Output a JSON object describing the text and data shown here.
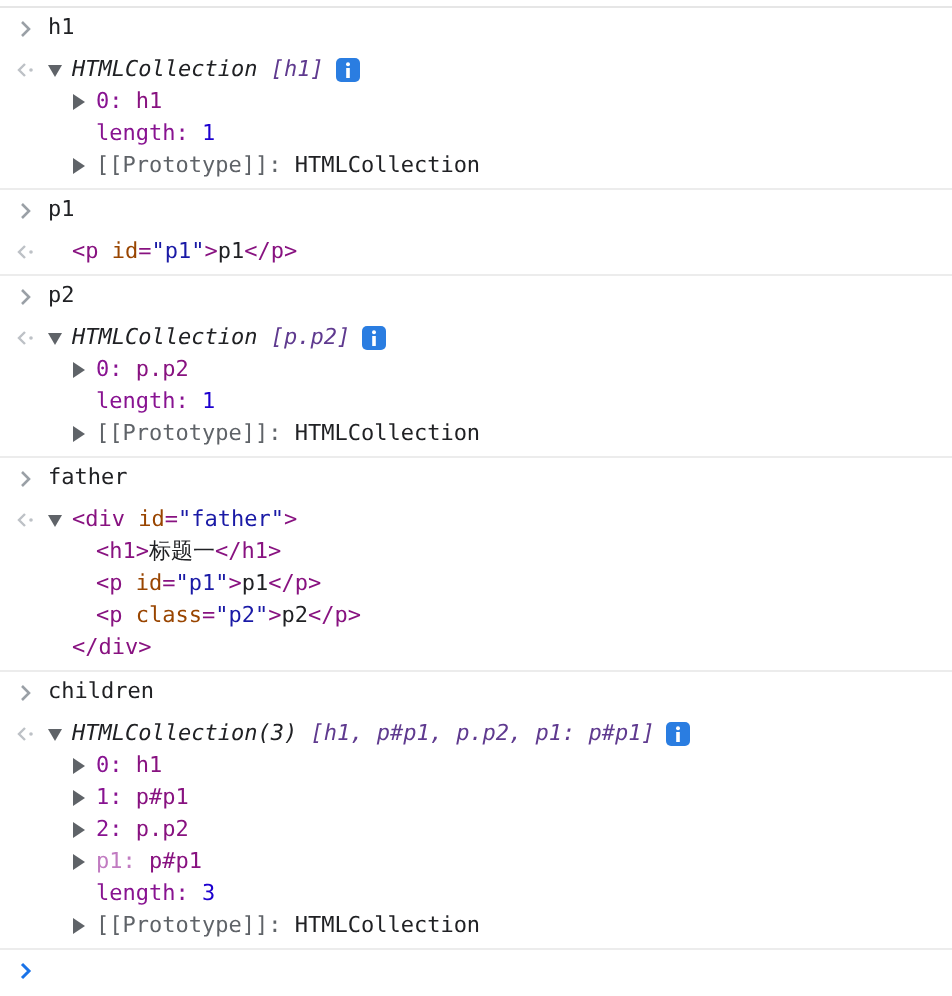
{
  "entries": [
    {
      "input": "h1",
      "output": {
        "kind": "collection",
        "expanded": true,
        "type": "HTMLCollection",
        "preview": "[h1]",
        "info": true,
        "properties": [
          {
            "key": "0:",
            "value": "h1",
            "kind": "index",
            "expanded": false
          },
          {
            "key": "length:",
            "value": "1",
            "kind": "number"
          },
          {
            "key": "[[Prototype]]:",
            "value": "HTMLCollection",
            "kind": "internal",
            "expanded": false
          }
        ]
      }
    },
    {
      "input": "p1",
      "output": {
        "kind": "element",
        "node": {
          "open": [
            {
              "kind": "tag",
              "text": "<p "
            },
            {
              "kind": "attr",
              "text": "id"
            },
            {
              "kind": "tag",
              "text": "="
            },
            {
              "kind": "value",
              "text": "\"p1\""
            },
            {
              "kind": "tag",
              "text": ">"
            },
            {
              "kind": "text",
              "text": "p1"
            },
            {
              "kind": "tag",
              "text": "</p>"
            }
          ]
        }
      }
    },
    {
      "input": "p2",
      "output": {
        "kind": "collection",
        "expanded": true,
        "type": "HTMLCollection",
        "preview": "[p.p2]",
        "info": true,
        "properties": [
          {
            "key": "0:",
            "value": "p.p2",
            "kind": "index",
            "expanded": false
          },
          {
            "key": "length:",
            "value": "1",
            "kind": "number"
          },
          {
            "key": "[[Prototype]]:",
            "value": "HTMLCollection",
            "kind": "internal",
            "expanded": false
          }
        ]
      }
    },
    {
      "input": "father",
      "output": {
        "kind": "element",
        "node": {
          "expanded": true,
          "open": [
            {
              "kind": "tag",
              "text": "<div "
            },
            {
              "kind": "attr",
              "text": "id"
            },
            {
              "kind": "tag",
              "text": "="
            },
            {
              "kind": "value",
              "text": "\"father\""
            },
            {
              "kind": "tag",
              "text": ">"
            }
          ],
          "children": [
            {
              "open": [
                {
                  "kind": "tag",
                  "text": "<h1>"
                },
                {
                  "kind": "text",
                  "text": "标题一"
                },
                {
                  "kind": "tag",
                  "text": "</h1>"
                }
              ]
            },
            {
              "open": [
                {
                  "kind": "tag",
                  "text": "<p "
                },
                {
                  "kind": "attr",
                  "text": "id"
                },
                {
                  "kind": "tag",
                  "text": "="
                },
                {
                  "kind": "value",
                  "text": "\"p1\""
                },
                {
                  "kind": "tag",
                  "text": ">"
                },
                {
                  "kind": "text",
                  "text": "p1"
                },
                {
                  "kind": "tag",
                  "text": "</p>"
                }
              ]
            },
            {
              "open": [
                {
                  "kind": "tag",
                  "text": "<p "
                },
                {
                  "kind": "attr",
                  "text": "class"
                },
                {
                  "kind": "tag",
                  "text": "="
                },
                {
                  "kind": "value",
                  "text": "\"p2\""
                },
                {
                  "kind": "tag",
                  "text": ">"
                },
                {
                  "kind": "text",
                  "text": "p2"
                },
                {
                  "kind": "tag",
                  "text": "</p>"
                }
              ]
            }
          ],
          "close": [
            {
              "kind": "tag",
              "text": "</div>"
            }
          ]
        }
      }
    },
    {
      "input": "children",
      "output": {
        "kind": "collection",
        "expanded": true,
        "type": "HTMLCollection(3)",
        "preview": "[h1, p#p1, p.p2, p1: p#p1]",
        "info": true,
        "properties": [
          {
            "key": "0:",
            "value": "h1",
            "kind": "index",
            "expanded": false
          },
          {
            "key": "1:",
            "value": "p#p1",
            "kind": "index",
            "expanded": false
          },
          {
            "key": "2:",
            "value": "p.p2",
            "kind": "index",
            "expanded": false
          },
          {
            "key": "p1:",
            "value": "p#p1",
            "kind": "named",
            "expanded": false
          },
          {
            "key": "length:",
            "value": "3",
            "kind": "number"
          },
          {
            "key": "[[Prototype]]:",
            "value": "HTMLCollection",
            "kind": "internal",
            "expanded": false
          }
        ]
      }
    }
  ]
}
